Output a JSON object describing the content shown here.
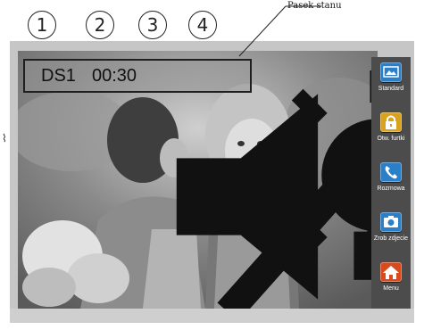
{
  "callouts": [
    "1",
    "2",
    "3",
    "4"
  ],
  "annotation": {
    "label": "Pasek stanu"
  },
  "status_bar": {
    "door_station": "DS1",
    "timer": "00:30",
    "mute_icon": "speaker-muted-icon",
    "light_icon": "light-bulb-icon"
  },
  "side_menu": {
    "items": [
      {
        "label": "Standard",
        "icon": "monitor-icon",
        "color": "#2a7fc9"
      },
      {
        "label": "Otw. furtki",
        "icon": "lock-icon",
        "color": "#d9a21c"
      },
      {
        "label": "Rozmowa",
        "icon": "phone-icon",
        "color": "#2a7fc9"
      },
      {
        "label": "Zrob zdjecie",
        "icon": "camera-icon",
        "color": "#2a7fc9"
      },
      {
        "label": "Menu",
        "icon": "home-icon",
        "color": "#d94a1c"
      }
    ]
  },
  "side_mark": "⌇"
}
